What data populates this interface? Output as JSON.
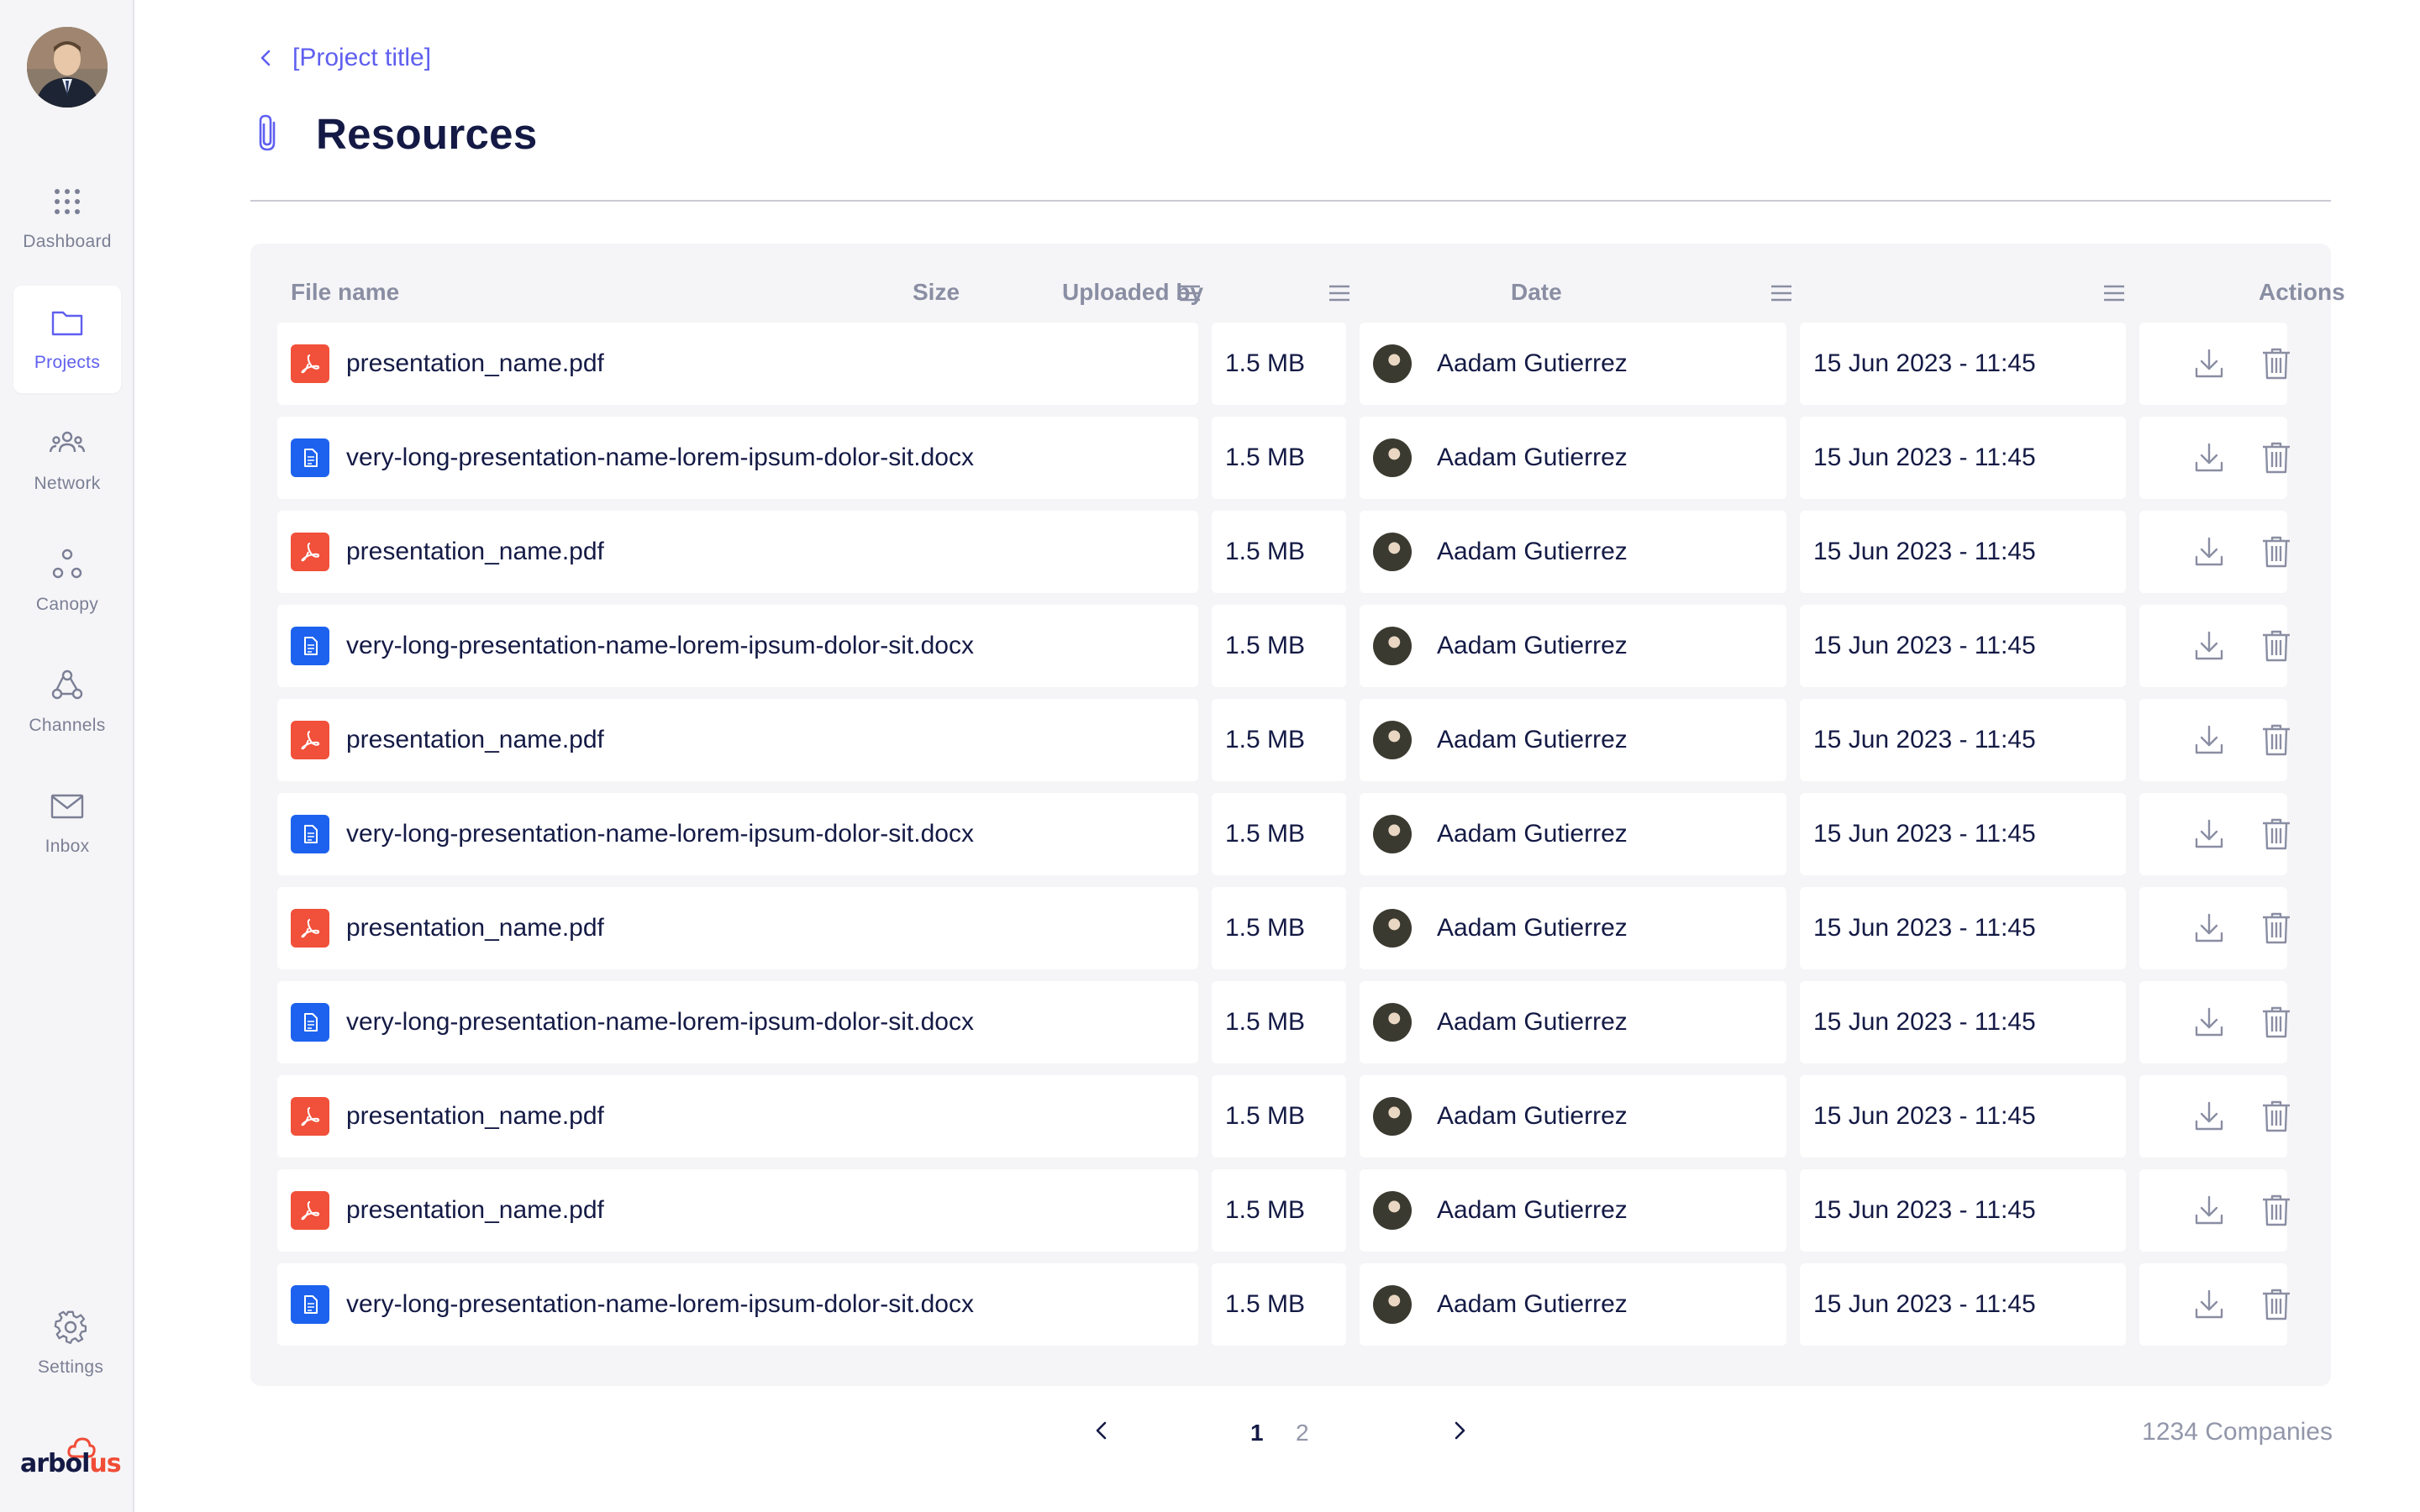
{
  "sidebar": {
    "items": [
      {
        "label": "Dashboard",
        "icon": "grid-dots-icon"
      },
      {
        "label": "Projects",
        "icon": "folder-icon",
        "active": true
      },
      {
        "label": "Network",
        "icon": "people-icon"
      },
      {
        "label": "Canopy",
        "icon": "circles-icon"
      },
      {
        "label": "Channels",
        "icon": "webhook-icon"
      },
      {
        "label": "Inbox",
        "icon": "envelope-icon"
      }
    ],
    "settings_label": "Settings",
    "logo": {
      "part1": "arbol",
      "part2": "us"
    }
  },
  "header": {
    "breadcrumb": "[Project title]",
    "title": "Resources"
  },
  "table": {
    "columns": [
      "File name",
      "Size",
      "Uploaded by",
      "Date",
      "Actions"
    ],
    "rows": [
      {
        "name": "presentation_name.pdf",
        "type": "pdf",
        "size": "1.5 MB",
        "user": "Aadam Gutierrez",
        "date": "15 Jun 2023 - 11:45"
      },
      {
        "name": "very-long-presentation-name-lorem-ipsum-dolor-sit.docx",
        "type": "docx",
        "size": "1.5 MB",
        "user": "Aadam Gutierrez",
        "date": "15 Jun 2023 - 11:45"
      },
      {
        "name": "presentation_name.pdf",
        "type": "pdf",
        "size": "1.5 MB",
        "user": "Aadam Gutierrez",
        "date": "15 Jun 2023 - 11:45"
      },
      {
        "name": "very-long-presentation-name-lorem-ipsum-dolor-sit.docx",
        "type": "docx",
        "size": "1.5 MB",
        "user": "Aadam Gutierrez",
        "date": "15 Jun 2023 - 11:45"
      },
      {
        "name": "presentation_name.pdf",
        "type": "pdf",
        "size": "1.5 MB",
        "user": "Aadam Gutierrez",
        "date": "15 Jun 2023 - 11:45"
      },
      {
        "name": "very-long-presentation-name-lorem-ipsum-dolor-sit.docx",
        "type": "docx",
        "size": "1.5 MB",
        "user": "Aadam Gutierrez",
        "date": "15 Jun 2023 - 11:45"
      },
      {
        "name": "presentation_name.pdf",
        "type": "pdf",
        "size": "1.5 MB",
        "user": "Aadam Gutierrez",
        "date": "15 Jun 2023 - 11:45"
      },
      {
        "name": "very-long-presentation-name-lorem-ipsum-dolor-sit.docx",
        "type": "docx",
        "size": "1.5 MB",
        "user": "Aadam Gutierrez",
        "date": "15 Jun 2023 - 11:45"
      },
      {
        "name": "presentation_name.pdf",
        "type": "pdf",
        "size": "1.5 MB",
        "user": "Aadam Gutierrez",
        "date": "15 Jun 2023 - 11:45"
      },
      {
        "name": "presentation_name.pdf",
        "type": "pdf",
        "size": "1.5 MB",
        "user": "Aadam Gutierrez",
        "date": "15 Jun 2023 - 11:45"
      },
      {
        "name": "very-long-presentation-name-lorem-ipsum-dolor-sit.docx",
        "type": "docx",
        "size": "1.5 MB",
        "user": "Aadam Gutierrez",
        "date": "15 Jun 2023 - 11:45"
      }
    ],
    "actions": [
      "download-icon",
      "trash-icon"
    ]
  },
  "pagination": {
    "pages": [
      "1",
      "2"
    ],
    "current": "1",
    "total_label": "1234 Companies"
  },
  "colors": {
    "accent": "#5f5ff0",
    "pdf": "#f1503a",
    "docx": "#1d62ee",
    "title": "#141a45"
  }
}
